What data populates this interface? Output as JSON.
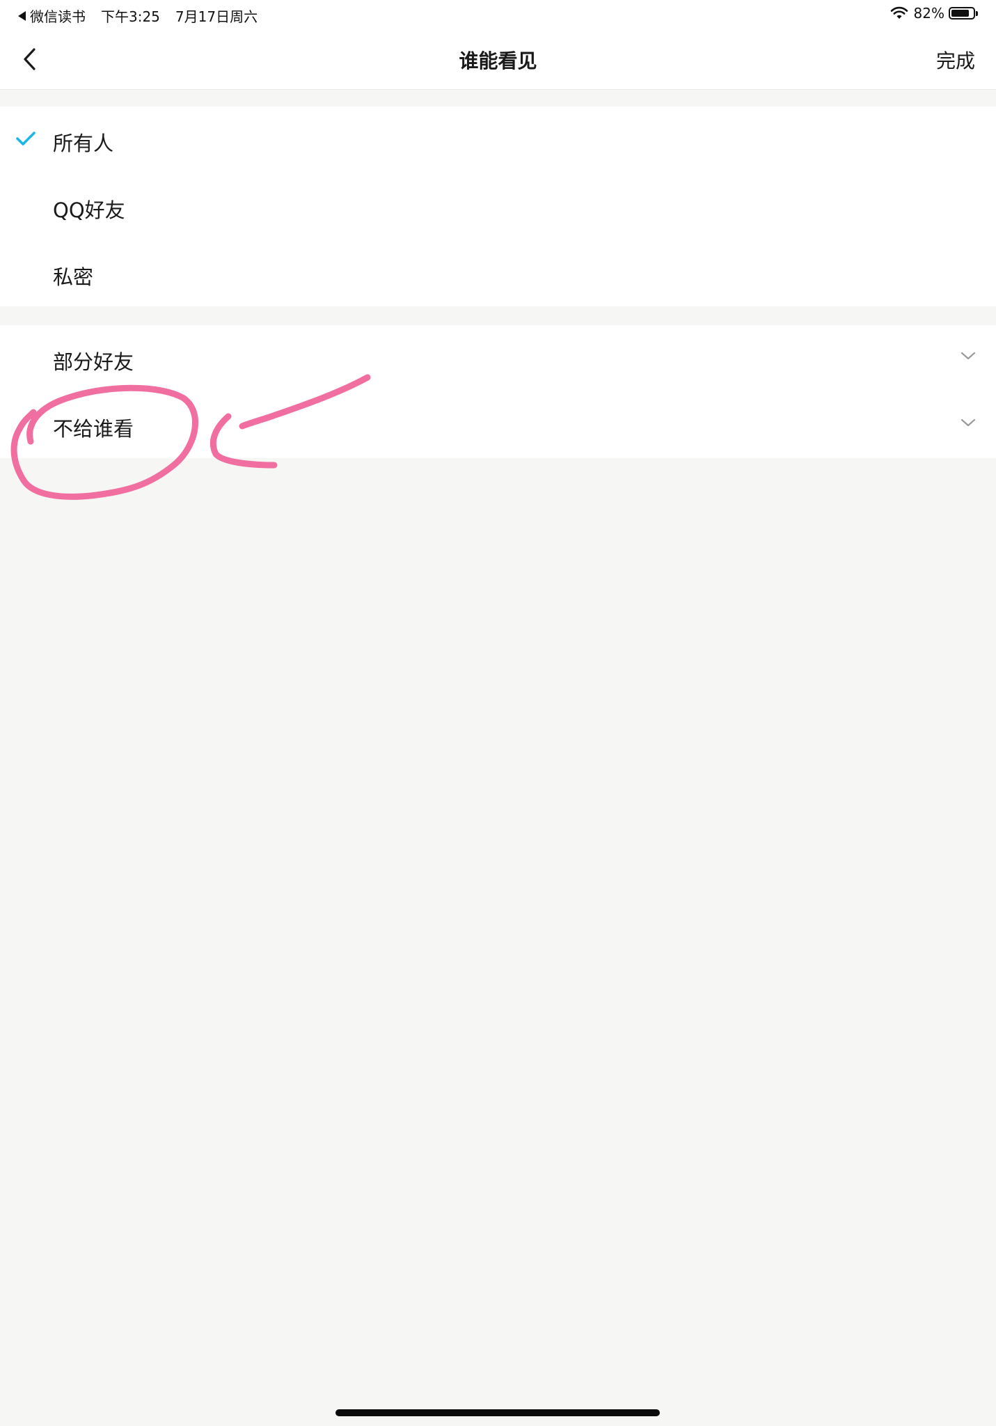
{
  "status_bar": {
    "back_app": "微信读书",
    "time": "下午3:25",
    "date": "7月17日周六",
    "battery_text": "82%",
    "battery_level": 0.82
  },
  "nav": {
    "title": "谁能看见",
    "done_label": "完成",
    "back_icon": "chevron-left-icon"
  },
  "options": [
    {
      "label": "所有人",
      "selected": true
    },
    {
      "label": "QQ好友",
      "selected": false
    },
    {
      "label": "私密",
      "selected": false
    }
  ],
  "expandable_options": [
    {
      "label": "部分好友",
      "icon": "chevron-down-icon"
    },
    {
      "label": "不给谁看",
      "icon": "chevron-down-icon"
    }
  ],
  "colors": {
    "accent": "#1ab6e8",
    "annotation": "#f06ea0",
    "background": "#f6f6f5"
  }
}
